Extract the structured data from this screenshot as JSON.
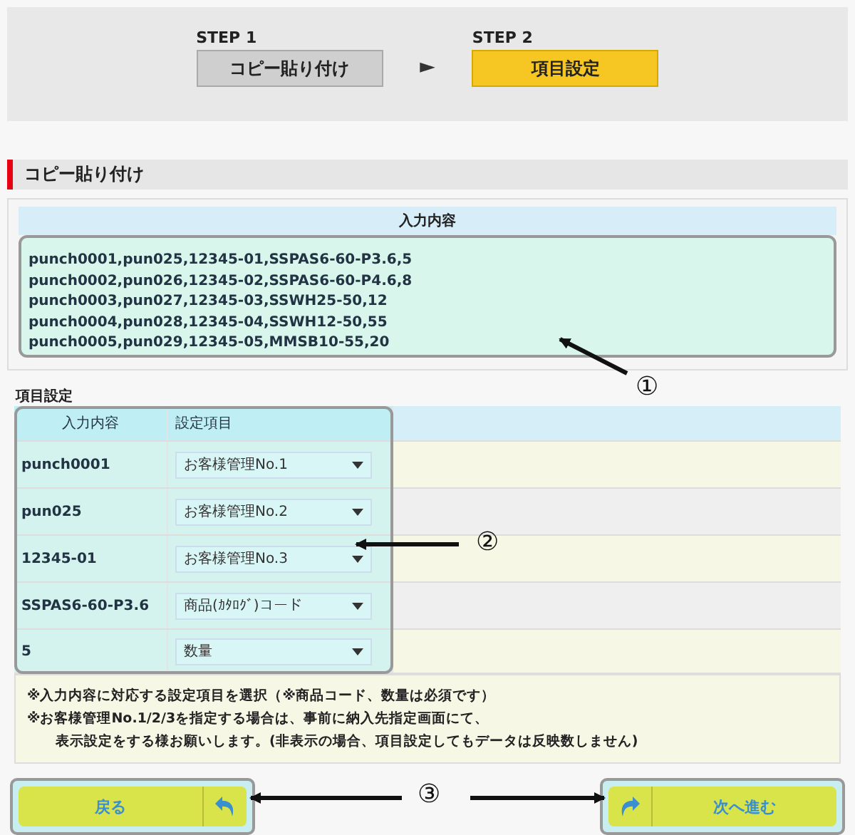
{
  "steps": [
    {
      "label": "STEP 1",
      "title": "コピー貼り付け",
      "selected": false
    },
    {
      "label": "STEP 2",
      "title": "項目設定",
      "selected": true
    }
  ],
  "step_arrow": "►",
  "section_title": "コピー貼り付け",
  "input_panel": {
    "heading": "入力内容",
    "lines": [
      "punch0001,pun025,12345-01,SSPAS6-60-P3.6,5",
      "punch0002,pun026,12345-02,SSPAS6-60-P4.6,8",
      "punch0003,pun027,12345-03,SSWH25-50,12",
      "punch0004,pun028,12345-04,SSWH12-50,55",
      "punch0005,pun029,12345-05,MMSB10-55,20"
    ]
  },
  "mapping": {
    "title": "項目設定",
    "columns": [
      "入力内容",
      "設定項目"
    ],
    "rows": [
      {
        "input": "punch0001",
        "setting": "お客様管理No.1"
      },
      {
        "input": "pun025",
        "setting": "お客様管理No.2"
      },
      {
        "input": "12345-01",
        "setting": "お客様管理No.3"
      },
      {
        "input": "SSPAS6-60-P3.6",
        "setting": "商品(ｶﾀﾛｸﾞ)コード"
      },
      {
        "input": "5",
        "setting": "数量"
      }
    ]
  },
  "notes": [
    "※入力内容に対応する設定項目を選択（※商品コード、数量は必須です）",
    "※お客様管理No.1/2/3を指定する場合は、事前に納入先指定画面にて、",
    "表示設定をする様お願いします。(非表示の場合、項目設定してもデータは反映数しません)"
  ],
  "buttons": [
    {
      "kind": "back",
      "label": "戻る"
    },
    {
      "kind": "next",
      "label": "次へ進む"
    }
  ],
  "callouts": [
    {
      "number": "①"
    },
    {
      "number": "②"
    },
    {
      "number": "③"
    }
  ]
}
